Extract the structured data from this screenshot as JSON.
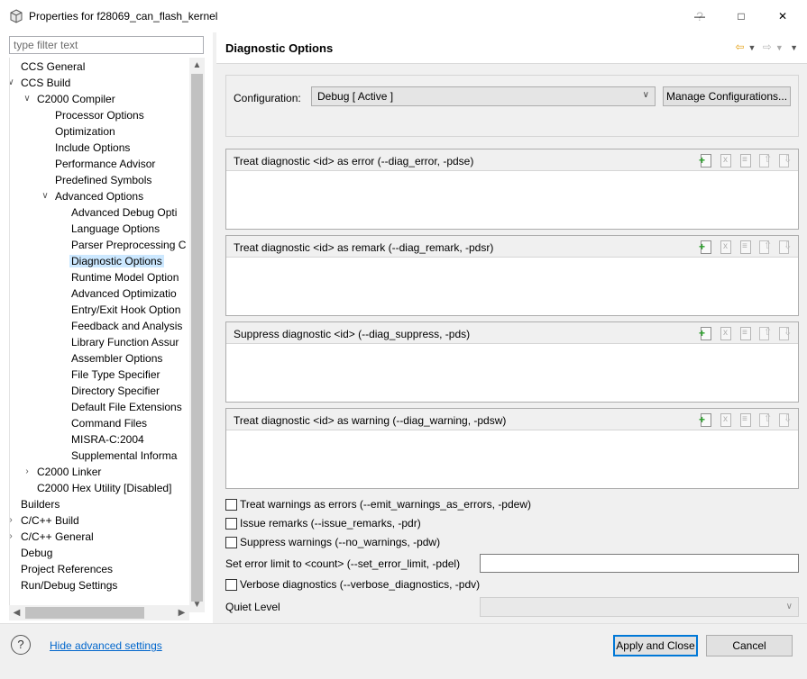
{
  "window": {
    "title": "Properties for f28069_can_flash_kernel",
    "help_glyph": "?",
    "minimize_glyph": "—",
    "maximize_glyph": "□",
    "close_glyph": "✕"
  },
  "filter": {
    "placeholder": "type filter text",
    "value": ""
  },
  "tree": [
    {
      "label": "CCS General",
      "depth": 0,
      "twisty": ""
    },
    {
      "label": "CCS Build",
      "depth": 0,
      "twisty": "expanded"
    },
    {
      "label": "C2000 Compiler",
      "depth": 1,
      "twisty": "expanded"
    },
    {
      "label": "Processor Options",
      "depth": 2,
      "twisty": ""
    },
    {
      "label": "Optimization",
      "depth": 2,
      "twisty": ""
    },
    {
      "label": "Include Options",
      "depth": 2,
      "twisty": ""
    },
    {
      "label": "Performance Advisor",
      "depth": 2,
      "twisty": ""
    },
    {
      "label": "Predefined Symbols",
      "depth": 2,
      "twisty": ""
    },
    {
      "label": "Advanced Options",
      "depth": 2,
      "twisty": "expanded"
    },
    {
      "label": "Advanced Debug Opti",
      "depth": 3,
      "twisty": ""
    },
    {
      "label": "Language Options",
      "depth": 3,
      "twisty": ""
    },
    {
      "label": "Parser Preprocessing C",
      "depth": 3,
      "twisty": ""
    },
    {
      "label": "Diagnostic Options",
      "depth": 3,
      "twisty": "",
      "selected": true
    },
    {
      "label": "Runtime Model Option",
      "depth": 3,
      "twisty": ""
    },
    {
      "label": "Advanced Optimizatio",
      "depth": 3,
      "twisty": ""
    },
    {
      "label": "Entry/Exit Hook Option",
      "depth": 3,
      "twisty": ""
    },
    {
      "label": "Feedback and Analysis",
      "depth": 3,
      "twisty": ""
    },
    {
      "label": "Library Function Assur",
      "depth": 3,
      "twisty": ""
    },
    {
      "label": "Assembler Options",
      "depth": 3,
      "twisty": ""
    },
    {
      "label": "File Type Specifier",
      "depth": 3,
      "twisty": ""
    },
    {
      "label": "Directory Specifier",
      "depth": 3,
      "twisty": ""
    },
    {
      "label": "Default File Extensions",
      "depth": 3,
      "twisty": ""
    },
    {
      "label": "Command Files",
      "depth": 3,
      "twisty": ""
    },
    {
      "label": "MISRA-C:2004",
      "depth": 3,
      "twisty": ""
    },
    {
      "label": "Supplemental Informa",
      "depth": 3,
      "twisty": ""
    },
    {
      "label": "C2000 Linker",
      "depth": 1,
      "twisty": "collapsed"
    },
    {
      "label": "C2000 Hex Utility  [Disabled]",
      "depth": 1,
      "twisty": ""
    },
    {
      "label": "Builders",
      "depth": 0,
      "twisty": ""
    },
    {
      "label": "C/C++ Build",
      "depth": 0,
      "twisty": "collapsed"
    },
    {
      "label": "C/C++ General",
      "depth": 0,
      "twisty": "collapsed"
    },
    {
      "label": "Debug",
      "depth": 0,
      "twisty": ""
    },
    {
      "label": "Project References",
      "depth": 0,
      "twisty": ""
    },
    {
      "label": "Run/Debug Settings",
      "depth": 0,
      "twisty": ""
    }
  ],
  "page": {
    "title": "Diagnostic Options",
    "nav_icons": [
      "back-arrow-icon",
      "forward-arrow-icon",
      "view-menu-icon"
    ]
  },
  "configuration": {
    "label": "Configuration:",
    "selected": "Debug  [ Active ]",
    "manage_label": "Manage Configurations..."
  },
  "lists": [
    {
      "title": "Treat diagnostic <id> as error (--diag_error, -pdse)"
    },
    {
      "title": "Treat diagnostic <id> as remark (--diag_remark, -pdsr)"
    },
    {
      "title": "Suppress diagnostic <id> (--diag_suppress, -pds)"
    },
    {
      "title": "Treat diagnostic <id> as warning (--diag_warning, -pdsw)"
    }
  ],
  "checks": [
    {
      "label": "Treat warnings as errors (--emit_warnings_as_errors, -pdew)",
      "checked": false
    },
    {
      "label": "Issue remarks (--issue_remarks, -pdr)",
      "checked": false
    },
    {
      "label": "Suppress warnings (--no_warnings, -pdw)",
      "checked": false
    }
  ],
  "error_limit": {
    "label": "Set error limit to <count> (--set_error_limit, -pdel)",
    "value": ""
  },
  "verbose": {
    "label": "Verbose diagnostics (--verbose_diagnostics, -pdv)",
    "checked": false
  },
  "quiet": {
    "label": "Quiet Level",
    "value": ""
  },
  "footer": {
    "help_glyph": "?",
    "hide_link": "Hide advanced settings",
    "apply_label": "Apply and Close",
    "cancel_label": "Cancel"
  }
}
